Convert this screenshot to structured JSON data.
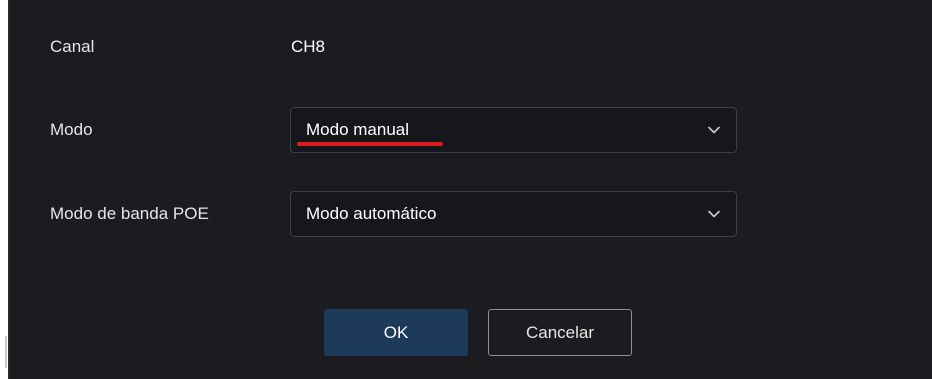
{
  "dialog": {
    "canal": {
      "label": "Canal",
      "value": "CH8"
    },
    "modo": {
      "label": "Modo",
      "selected": "Modo manual"
    },
    "poe": {
      "label": "Modo de banda POE",
      "selected": "Modo automático"
    },
    "buttons": {
      "ok": "OK",
      "cancel": "Cancelar"
    }
  },
  "colors": {
    "dialog_bg": "#1b1c1f",
    "ok_button": "#1d3a5a",
    "highlight_underline": "#e0191e"
  },
  "icons": {
    "dropdown": "chevron-down-icon"
  }
}
